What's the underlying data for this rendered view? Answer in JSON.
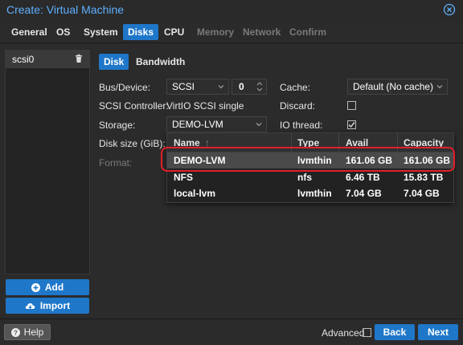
{
  "window": {
    "title": "Create: Virtual Machine"
  },
  "tabs": [
    {
      "label": "General",
      "state": "normal"
    },
    {
      "label": "OS",
      "state": "normal"
    },
    {
      "label": "System",
      "state": "normal"
    },
    {
      "label": "Disks",
      "state": "active"
    },
    {
      "label": "CPU",
      "state": "normal"
    },
    {
      "label": "Memory",
      "state": "disabled"
    },
    {
      "label": "Network",
      "state": "disabled"
    },
    {
      "label": "Confirm",
      "state": "disabled"
    }
  ],
  "disk_list": {
    "items": [
      "scsi0"
    ]
  },
  "left_buttons": {
    "add": "Add",
    "import": "Import"
  },
  "subtabs": [
    "Disk",
    "Bandwidth"
  ],
  "form": {
    "bus_device_label": "Bus/Device:",
    "bus_value": "SCSI",
    "device_index": "0",
    "scsi_controller_label": "SCSI Controller:",
    "scsi_controller_value": "VirtIO SCSI single",
    "storage_label": "Storage:",
    "storage_value": "DEMO-LVM",
    "disk_size_label": "Disk size (GiB):",
    "format_label": "Format:",
    "cache_label": "Cache:",
    "cache_value": "Default (No cache)",
    "discard_label": "Discard:",
    "discard_checked": false,
    "io_thread_label": "IO thread:",
    "io_thread_checked": true
  },
  "storage_grid": {
    "columns": [
      "Name",
      "Type",
      "Avail",
      "Capacity"
    ],
    "rows": [
      {
        "name": "DEMO-LVM",
        "type": "lvmthin",
        "avail": "161.06 GB",
        "capacity": "161.06 GB",
        "selected": true
      },
      {
        "name": "NFS",
        "type": "nfs",
        "avail": "6.46 TB",
        "capacity": "15.83 TB",
        "selected": false
      },
      {
        "name": "local-lvm",
        "type": "lvmthin",
        "avail": "7.04 GB",
        "capacity": "7.04 GB",
        "selected": false
      }
    ]
  },
  "footer": {
    "help": "Help",
    "advanced": "Advanced",
    "back": "Back",
    "next": "Next"
  },
  "colors": {
    "accent": "#1f77c9",
    "title": "#5fb0ff",
    "highlight": "#e0202a"
  }
}
